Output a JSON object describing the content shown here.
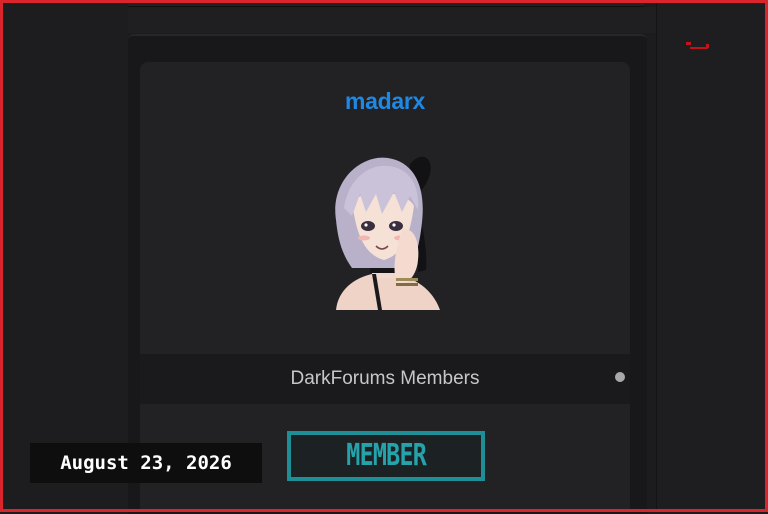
{
  "profile": {
    "username": "madarx",
    "group_name": "DarkForums Members",
    "rank_badge": "MEMBER",
    "avatar_icon": "anime-avatar-icon"
  },
  "overlay": {
    "date_stamp": "August 23, 2026"
  },
  "colors": {
    "username": "#1e88e5",
    "badge": "#1f8f97",
    "frame": "#d9262c",
    "background": "#1c1c1e"
  }
}
